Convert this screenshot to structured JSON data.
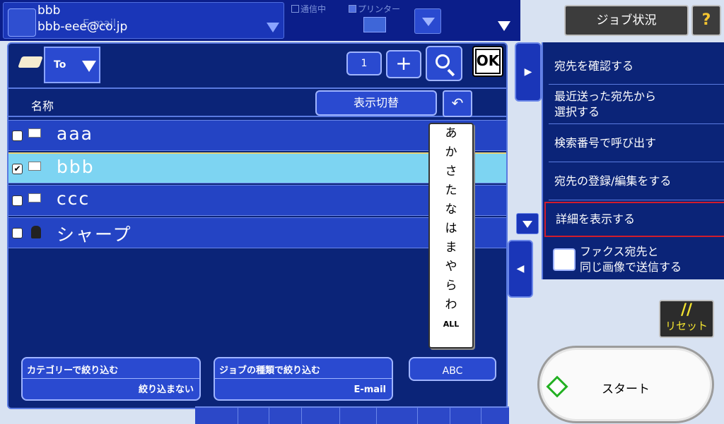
{
  "topbar": {
    "dest_name": "bbb",
    "dest_address": "bbb-eee@co.jp",
    "dest_mode": "E-mail",
    "status_comm": "通信中",
    "status_printer": "プリンター"
  },
  "header_buttons": {
    "job_status": "ジョブ状況",
    "help": "?"
  },
  "dialog": {
    "to_label": "To",
    "count": "1",
    "plus": "+",
    "ok": "OK",
    "name_header": "名称",
    "toggle_display": "表示切替",
    "entries": [
      {
        "name": "aaa",
        "type": "email",
        "checked": false
      },
      {
        "name": "bbb",
        "type": "email",
        "checked": true
      },
      {
        "name": "ccc",
        "type": "email",
        "checked": false
      },
      {
        "name": "シャープ",
        "type": "group",
        "checked": false
      }
    ],
    "index_tabs": [
      "あ",
      "か",
      "さ",
      "た",
      "な",
      "は",
      "ま",
      "や",
      "ら",
      "わ",
      "ALL"
    ],
    "filter_category": {
      "title": "カテゴリーで絞り込む",
      "value": "絞り込まない"
    },
    "filter_job": {
      "title": "ジョブの種類で絞り込む",
      "value": "E-mail"
    },
    "abc": "ABC"
  },
  "side_menu": {
    "items": [
      "宛先を確認する",
      "最近送った宛先から\n選択する",
      "検索番号で呼び出す",
      "宛先の登録/編集をする",
      "詳細を表示する"
    ],
    "fax_same_image": "ファクス宛先と\n同じ画像で送信する"
  },
  "reset": {
    "symbol": "//",
    "label": "リセット"
  },
  "start": {
    "label": "スタート"
  },
  "colors": {
    "panel": "#0b2478",
    "row": "#2444c4",
    "selected_row": "#7dd4f2",
    "highlight_border": "#d11c2c"
  }
}
